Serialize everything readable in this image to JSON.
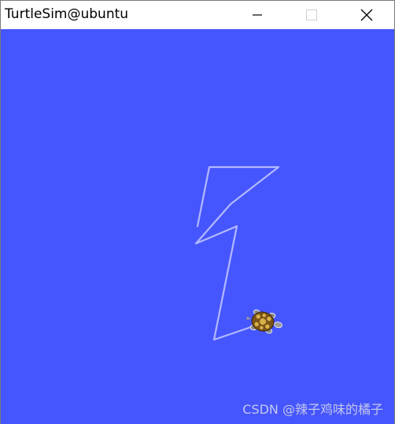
{
  "window": {
    "title": "TurtleSim@ubuntu",
    "controls": {
      "minimize_icon": "minimize-icon",
      "maximize_icon": "maximize-icon",
      "close_icon": "close-icon"
    }
  },
  "canvas": {
    "background_color": "#4556ff",
    "pen_color": "#b3b8ff"
  },
  "watermark": {
    "text": "CSDN @辣子鸡味的橘子"
  }
}
